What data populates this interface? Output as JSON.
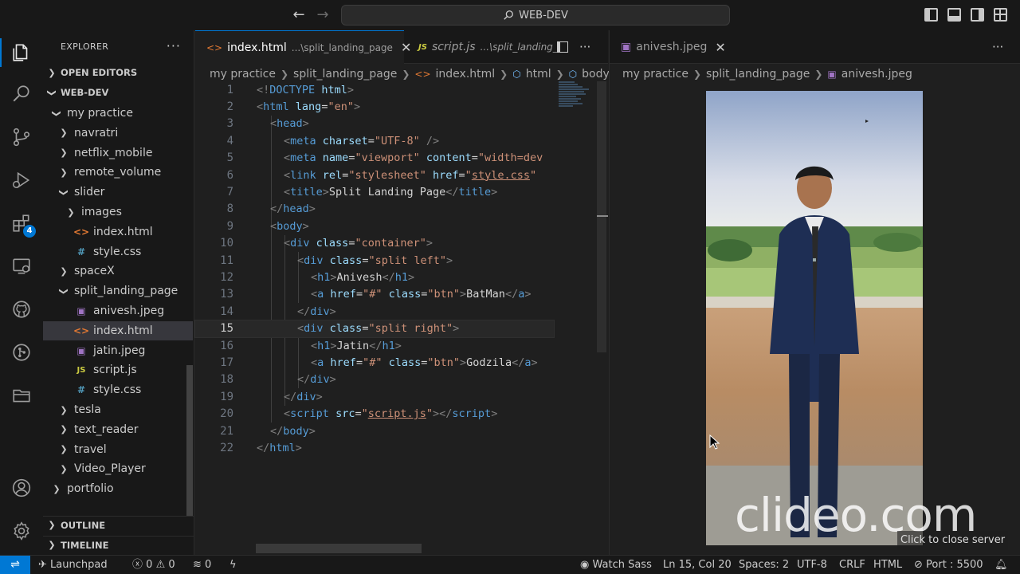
{
  "titlebar": {
    "search_text": "WEB-DEV"
  },
  "explorer": {
    "title": "EXPLORER",
    "open_editors": "OPEN EDITORS",
    "workspace": "WEB-DEV",
    "outline": "OUTLINE",
    "timeline": "TIMELINE",
    "tree": [
      {
        "label": "my practice",
        "type": "folder-open"
      },
      {
        "label": "navratri",
        "type": "folder"
      },
      {
        "label": "netflix_mobile",
        "type": "folder"
      },
      {
        "label": "remote_volume",
        "type": "folder"
      },
      {
        "label": "slider",
        "type": "folder-open"
      },
      {
        "label": "images",
        "type": "folder"
      },
      {
        "label": "index.html",
        "type": "html"
      },
      {
        "label": "style.css",
        "type": "css"
      },
      {
        "label": "spaceX",
        "type": "folder"
      },
      {
        "label": "split_landing_page",
        "type": "folder-open"
      },
      {
        "label": "anivesh.jpeg",
        "type": "image"
      },
      {
        "label": "index.html",
        "type": "html",
        "selected": true
      },
      {
        "label": "jatin.jpeg",
        "type": "image"
      },
      {
        "label": "script.js",
        "type": "js"
      },
      {
        "label": "style.css",
        "type": "css"
      },
      {
        "label": "tesla",
        "type": "folder"
      },
      {
        "label": "text_reader",
        "type": "folder"
      },
      {
        "label": "travel",
        "type": "folder"
      },
      {
        "label": "Video_Player",
        "type": "folder"
      },
      {
        "label": "portfolio",
        "type": "folder"
      }
    ],
    "extensions_badge": "4"
  },
  "editor1": {
    "tabs": [
      {
        "label": "index.html",
        "dir": "...\\split_landing_page",
        "active": true
      },
      {
        "label": "script.js",
        "dir": "...\\split_landing_"
      }
    ],
    "breadcrumb": [
      "my practice",
      "split_landing_page",
      "index.html",
      "html",
      "body"
    ],
    "lines": [
      "1",
      "2",
      "3",
      "4",
      "5",
      "6",
      "7",
      "8",
      "9",
      "10",
      "11",
      "12",
      "13",
      "14",
      "15",
      "16",
      "17",
      "18",
      "19",
      "20",
      "21",
      "22"
    ],
    "current_line": 15
  },
  "editor2": {
    "tab": "anivesh.jpeg",
    "breadcrumb": [
      "my practice",
      "split_landing_page",
      "anivesh.jpeg"
    ]
  },
  "overlay": {
    "watermark": "clideo.com",
    "tooltip": "Click to close server"
  },
  "statusbar": {
    "launchpad": "Launchpad",
    "errors": "0",
    "warnings": "0",
    "ports": "0",
    "watch_sass": "Watch Sass",
    "position": "Ln 15, Col 20",
    "spaces": "Spaces: 2",
    "encoding": "UTF-8",
    "eol": "CRLF",
    "language": "HTML",
    "port": "Port : 5500"
  },
  "colors": {
    "accent": "#0078d4",
    "tag": "#569cd6",
    "attr": "#9cdcfe",
    "string": "#ce9178"
  }
}
